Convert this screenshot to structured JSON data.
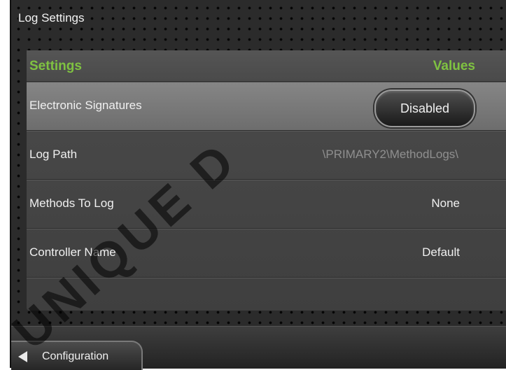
{
  "window": {
    "title": "Log Settings"
  },
  "table": {
    "header_settings": "Settings",
    "header_values": "Values",
    "rows": [
      {
        "label": "Electronic Signatures",
        "value": "Disabled",
        "control": "button"
      },
      {
        "label": "Log Path",
        "value": "\\PRIMARY2\\MethodLogs\\",
        "control": "text-dim"
      },
      {
        "label": "Methods To Log",
        "value": "None",
        "control": "text"
      },
      {
        "label": "Controller Name",
        "value": "Default",
        "control": "text"
      }
    ]
  },
  "footer": {
    "back_label": "Configuration",
    "back_icon": "triangle-left-icon"
  },
  "watermark": "UNIQUE D",
  "colors": {
    "header_accent": "#7fc241",
    "selected_row": "#7a7a7a",
    "panel": "#474747"
  }
}
